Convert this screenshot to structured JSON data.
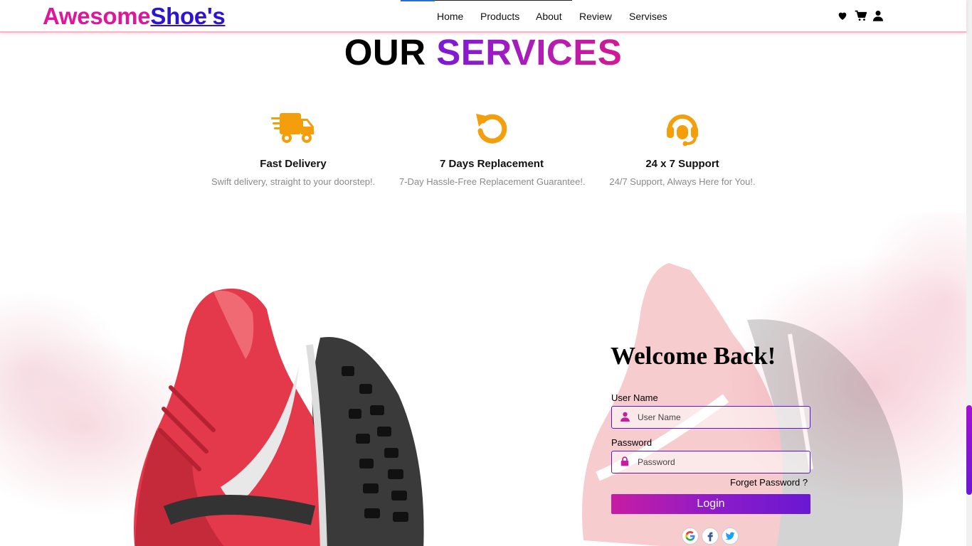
{
  "brand": {
    "part1": "Awesome",
    "part2": "Shoe's"
  },
  "nav": {
    "items": [
      "Home",
      "Products",
      "About",
      "Review",
      "Servises"
    ]
  },
  "header_icons": [
    "heart-icon",
    "cart-icon",
    "user-icon"
  ],
  "services": {
    "title_part1": "OUR",
    "title_part2": "SERVICES",
    "cards": [
      {
        "icon": "truck-icon",
        "title": "Fast Delivery",
        "desc": "Swift delivery, straight to your doorstep!."
      },
      {
        "icon": "rotate-icon",
        "title": "7 Days Replacement",
        "desc": "7-Day Hassle-Free Replacement Guarantee!."
      },
      {
        "icon": "headset-icon",
        "title": "24 x 7 Support",
        "desc": "24/7 Support, Always Here for You!."
      }
    ]
  },
  "login": {
    "heading": "Welcome Back!",
    "username_label": "User Name",
    "username_placeholder": "User Name",
    "password_label": "Password",
    "password_placeholder": "Password",
    "forgot": "Forget Password ?",
    "button": "Login",
    "social": [
      "google-icon",
      "facebook-icon",
      "twitter-icon"
    ]
  },
  "colors": {
    "brand_pink": "#e0169a",
    "brand_blue": "#2d13d6",
    "accent_orange": "#f59e0b",
    "accent_purple": "#7a1ad6",
    "field_border": "#5b17c9"
  }
}
